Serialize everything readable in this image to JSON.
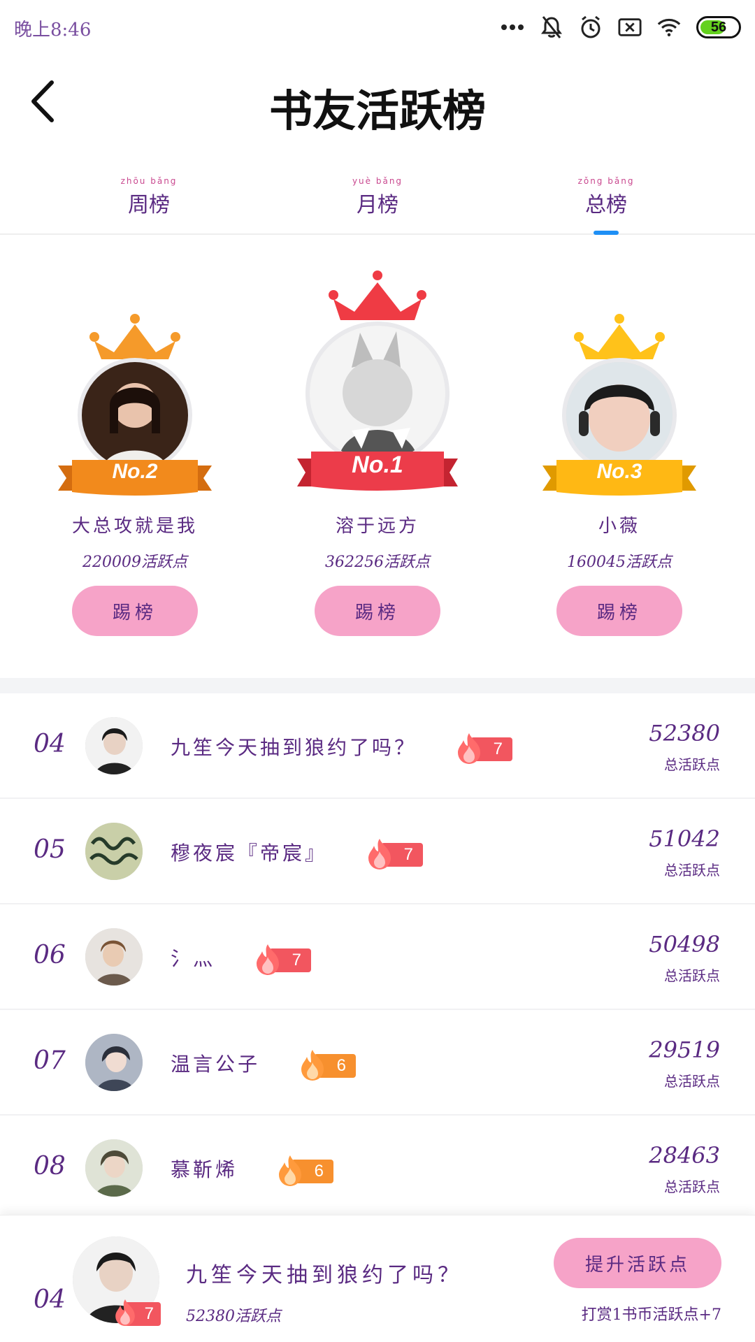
{
  "status_bar": {
    "time": "晚上8:46",
    "battery": "56",
    "icons": [
      "more-dots-icon",
      "bell-muted-icon",
      "alarm-icon",
      "sim-x-icon",
      "wifi-icon",
      "battery-icon"
    ],
    "battery_color": "#63d11e"
  },
  "header": {
    "title": "书友活跃榜",
    "back_icon": "chevron-left-icon"
  },
  "tabs": [
    {
      "pinyin": "zhōu bǎng",
      "label": "周榜"
    },
    {
      "pinyin": "yuè bǎng",
      "label": "月榜"
    },
    {
      "pinyin": "zǒng bǎng",
      "label": "总榜",
      "active": true
    }
  ],
  "podium": [
    {
      "rank_label": "No.2",
      "name": "大总攻就是我",
      "score": "220009活跃点",
      "button": "踢榜",
      "crown_color": "#f59a2a",
      "ribbon_color": "#f28a1c"
    },
    {
      "rank_label": "No.1",
      "name": "溶于远方",
      "score": "362256活跃点",
      "button": "踢榜",
      "crown_color": "#ef3b44",
      "ribbon_color": "#ec3c4a"
    },
    {
      "rank_label": "No.3",
      "name": "小薇",
      "score": "160045活跃点",
      "button": "踢榜",
      "crown_color": "#ffc21a",
      "ribbon_color": "#ffb814"
    }
  ],
  "list": [
    {
      "rank": "04",
      "name": "九笙今天抽到狼约了吗？",
      "level": "7",
      "score": "52380",
      "sub": "总活跃点",
      "badge_color": "#f2565f"
    },
    {
      "rank": "05",
      "name": "穆夜宸『帝宸』",
      "level": "7",
      "score": "51042",
      "sub": "总活跃点",
      "badge_color": "#f2565f"
    },
    {
      "rank": "06",
      "name": "氵灬",
      "level": "7",
      "score": "50498",
      "sub": "总活跃点",
      "badge_color": "#f2565f"
    },
    {
      "rank": "07",
      "name": "温言公子",
      "level": "6",
      "score": "29519",
      "sub": "总活跃点",
      "badge_color": "#f7902e"
    },
    {
      "rank": "08",
      "name": "慕靳烯",
      "level": "6",
      "score": "28463",
      "sub": "总活跃点",
      "badge_color": "#f7902e"
    }
  ],
  "me": {
    "rank": "04",
    "name": "九笙今天抽到狼约了吗？",
    "level": "7",
    "score": "52380活跃点",
    "button": "提升活跃点",
    "hint": "打赏1书币活跃点+7"
  },
  "colors": {
    "text_purple": "#5a2a82",
    "pink_button": "#f6a3c8",
    "tab_indicator": "#1e8ff5"
  }
}
